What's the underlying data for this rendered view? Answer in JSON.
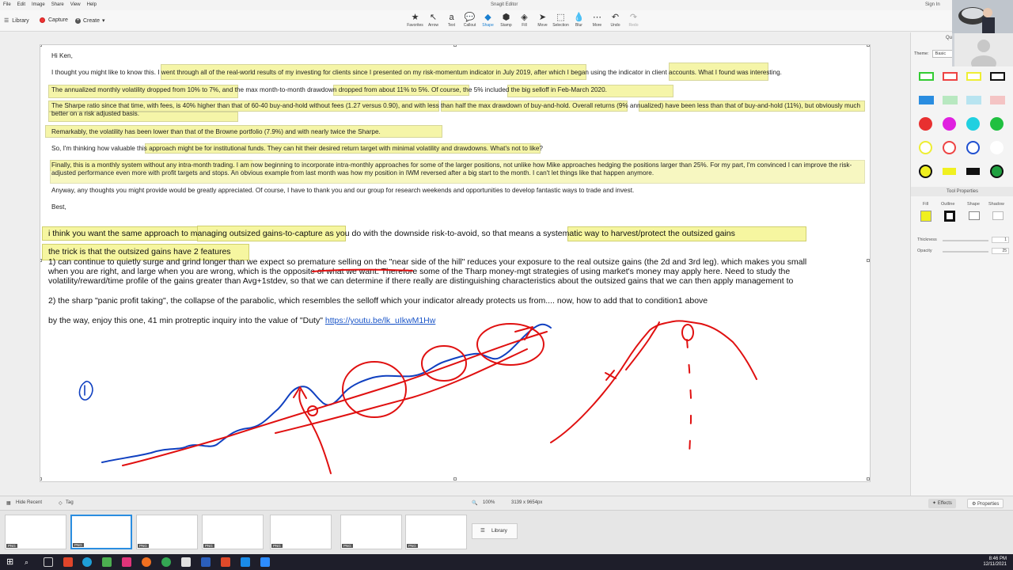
{
  "menubar": {
    "menus": [
      "File",
      "Edit",
      "Image",
      "Share",
      "View",
      "Help"
    ],
    "title": "Snagit Editor",
    "signin": "Sign In"
  },
  "toolbar": {
    "library": "Library",
    "capture": "Capture",
    "create": "Create",
    "tools": [
      {
        "label": "Favorites",
        "icon": "star-icon",
        "glyph": "★"
      },
      {
        "label": "Arrow",
        "icon": "arrow-icon",
        "glyph": "↖"
      },
      {
        "label": "Text",
        "icon": "text-icon",
        "glyph": "a"
      },
      {
        "label": "Callout",
        "icon": "callout-icon",
        "glyph": "💬"
      },
      {
        "label": "Shape",
        "icon": "shape-icon",
        "glyph": "◆"
      },
      {
        "label": "Stamp",
        "icon": "stamp-icon",
        "glyph": "⬢"
      },
      {
        "label": "Fill",
        "icon": "fill-icon",
        "glyph": "◈"
      },
      {
        "label": "Move",
        "icon": "move-icon",
        "glyph": "➤"
      },
      {
        "label": "Selection",
        "icon": "selection-icon",
        "glyph": "⬚"
      },
      {
        "label": "Blur",
        "icon": "blur-icon",
        "glyph": "💧"
      },
      {
        "label": "More",
        "icon": "more-icon",
        "glyph": "⋯"
      },
      {
        "label": "Undo",
        "icon": "undo-icon",
        "glyph": "↶"
      },
      {
        "label": "Redo",
        "icon": "redo-icon",
        "glyph": "↷"
      }
    ],
    "active_tool": "Shape"
  },
  "email": {
    "greeting": "Hi Ken,",
    "p1": "I thought you might like to know this. I went through all of the real-world results of my investing for clients since I presented on my risk-momentum indicator in July 2019, after which I began using the indicator in client accounts. What I found was interesting.",
    "p2": "The annualized monthly volatility dropped from 10% to 7%, and the max month-to-month drawdown dropped from about 11% to 5%. Of course, the 5% included the big selloff in Feb-March 2020.",
    "p3": "The Sharpe ratio since that time, with fees, is 40% higher than that of 60-40 buy-and-hold without fees (1.27 versus 0.90), and with less than half the max drawdown of buy-and-hold. Overall returns (9% annualized) have been less than that of buy-and-hold (11%), but obviously much better on a risk adjusted basis.",
    "p4": "Remarkably, the volatility has been lower than that of the Browne portfolio (7.9%) and with nearly twice the Sharpe.",
    "p5": "So, I'm thinking how valuable this approach might be for institutional funds. They can hit their desired return target with minimal volatility and drawdowns. What's not to like?",
    "p6": "Finally, this is a monthly system without any intra-month trading. I am now beginning to incorporate intra-monthly approaches for some of the larger positions, not unlike how Mike          approaches hedging the positions larger than 25%. For my part, I'm convinced I can improve the risk-adjusted performance even more with profit targets and stops. An obvious example from last month was how my position in IWM reversed after a big start to the month. I can't let things like that happen anymore.",
    "p7": "Anyway, any thoughts you might provide would be greatly appreciated. Of course, I have to thank you and our group for research weekends and opportunities to develop fantastic ways to trade and invest.",
    "closing": "Best,"
  },
  "notes": {
    "l1a": "i think you want the same approach to ",
    "l1b": "managing outsized gains-to-capture",
    "l1c": " as you do with the downside risk-to-avoid,  so that means ",
    "l1d": "a systematic way to harvest/protect the outsized gains",
    "l2": "the trick is that the outsized gains have 2 features",
    "l3": "1) can continue to quietly surge and grind longer than we expect so premature selling on the \"near side of the hill\" reduces your exposure to the real outsize gains (the 2d and 3rd leg). which makes you small",
    "l4": "when you are right, and large when you are wrong, which is the opposite of what we want.  Therefore some of the Tharp money-mgt strategies of using market's money may apply here. Need to study the",
    "l5": "volatility/reward/time profile of the gains greater than Avg+1stdev, so that we can determine if there really are distinguishing characteristics about the outsized gains that we can then apply management to",
    "l6": "2) the sharp \"panic profit taking\", the collapse of the parabolic, which resembles the selloff which your indicator already protects us from....  now, how to add that to condition1  above",
    "l7": "by the way, enjoy this one, 41 min protreptic inquiry into the value of \"Duty\"  ",
    "link": "https://youtu.be/lk_uIkwM1Hw",
    "handwritten_label": "1",
    "handwritten_x": "x"
  },
  "right_panel": {
    "title": "Qu",
    "theme_label": "Theme:",
    "theme_value": "Basic",
    "tool_properties": "Tool Properties",
    "fill": "Fill",
    "outline": "Outline",
    "shape": "Shape",
    "shadow": "Shadow",
    "thickness": "Thickness",
    "thickness_value": "1",
    "opacity": "Opacity",
    "opacity_value": "25"
  },
  "statusbar": {
    "hide_recent": "Hide Recent",
    "tag": "Tag",
    "zoom": "100%",
    "dimensions": "3139 x 9654px",
    "effects": "Effects",
    "properties": "Properties"
  },
  "tray": {
    "library": "Library",
    "thumb_tag": "PNG"
  },
  "taskbar": {
    "time": "8:46 PM",
    "date": "12/11/2021"
  },
  "colors": {
    "highlight": "#f5f5a8",
    "accent": "#2a8de0",
    "ink_red": "#e01010",
    "ink_blue": "#1040c0"
  }
}
